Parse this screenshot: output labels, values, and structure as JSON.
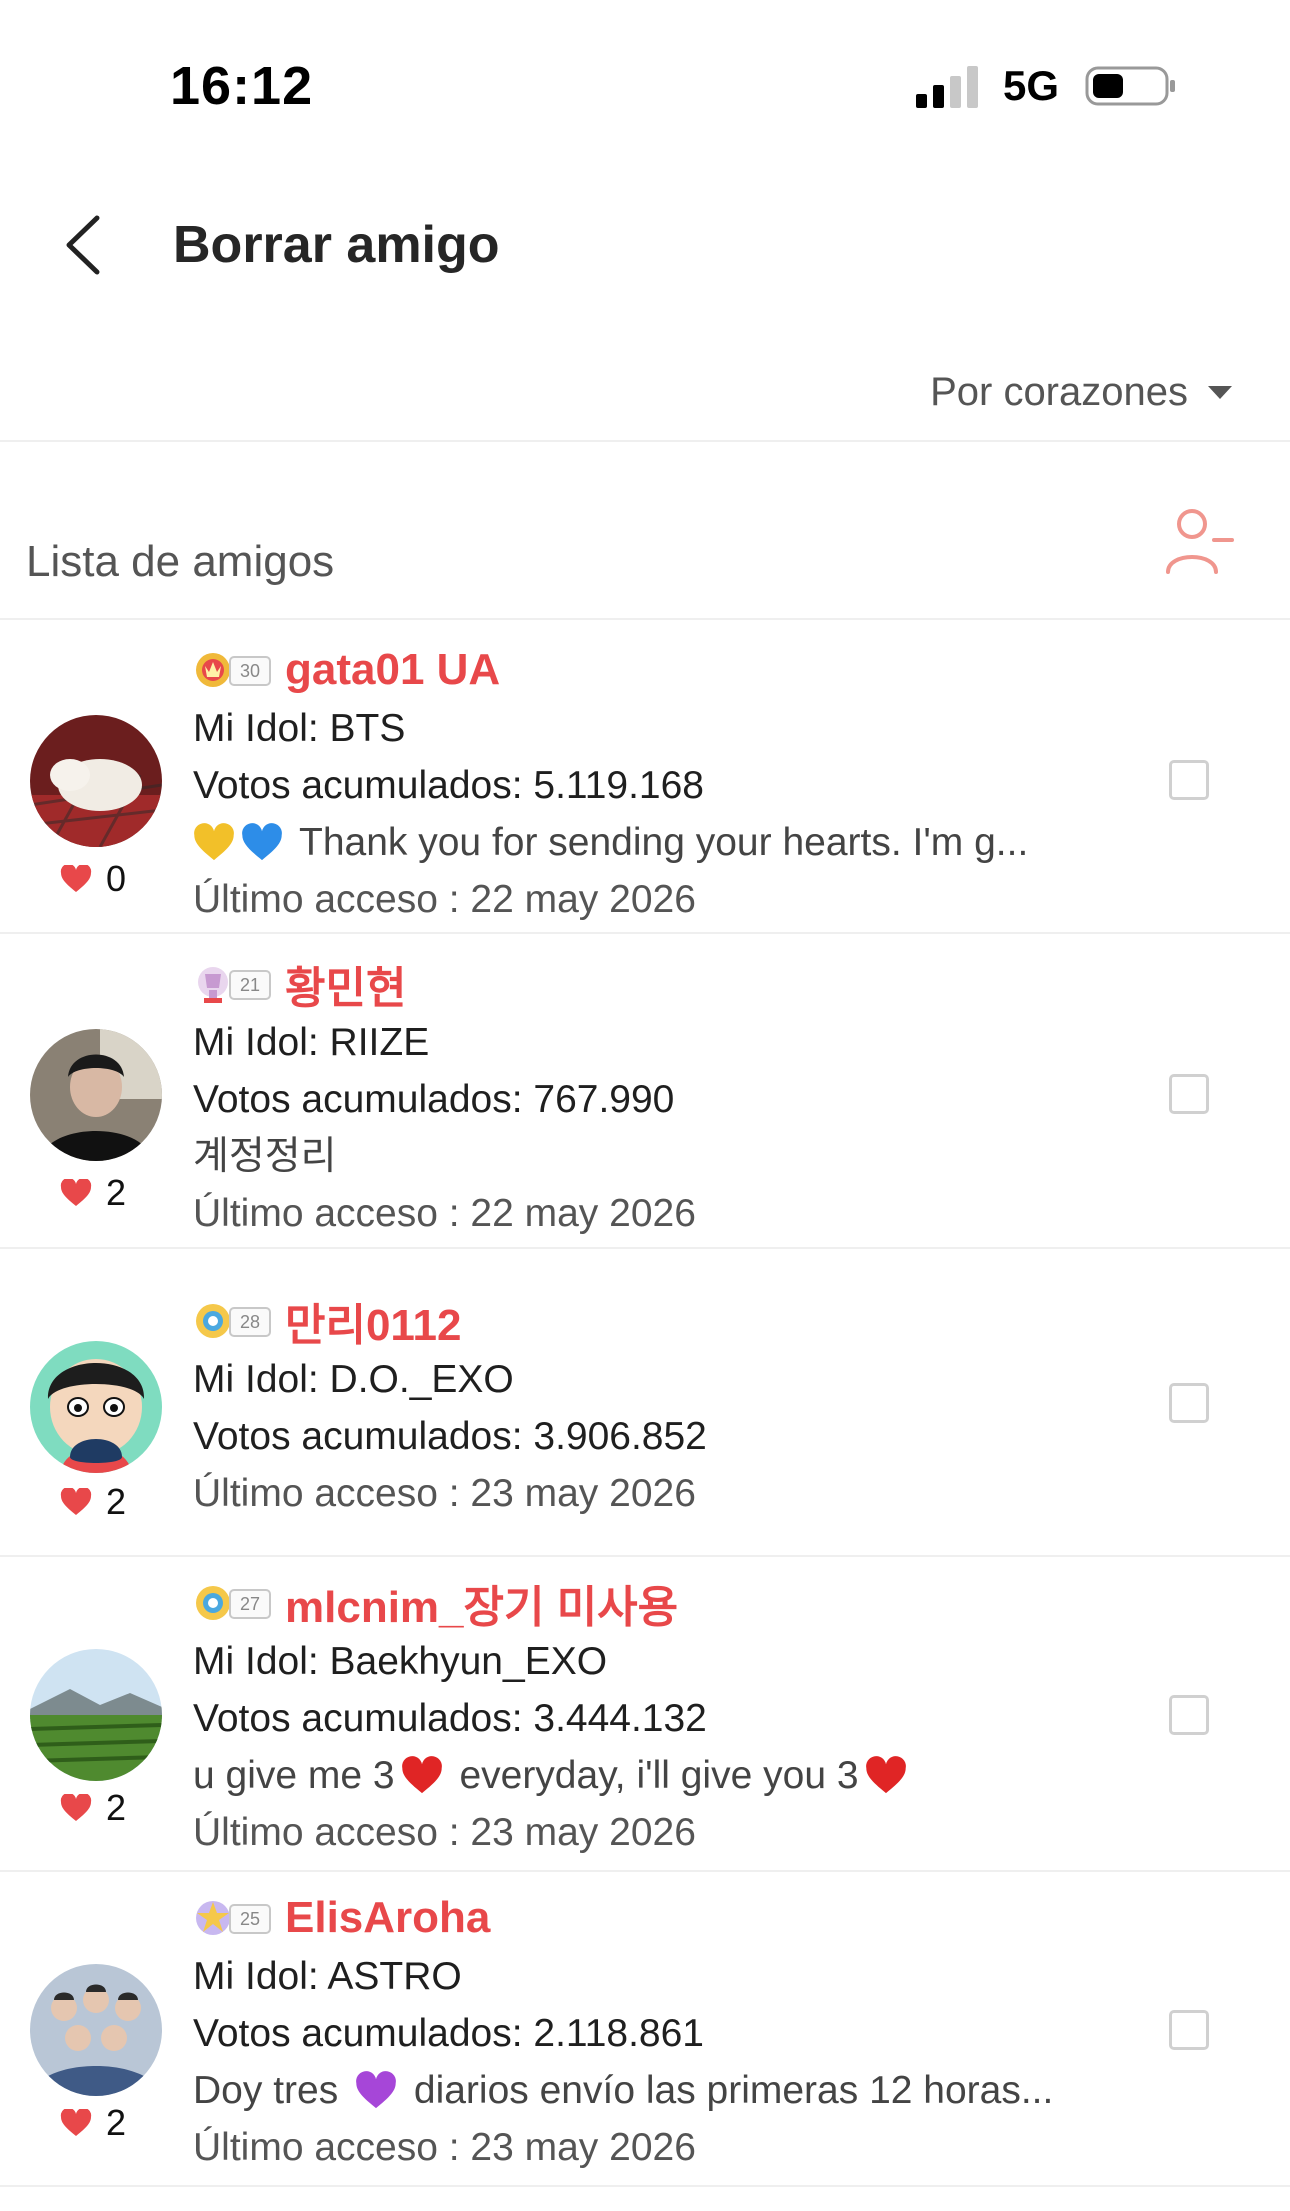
{
  "status_bar": {
    "time": "16:12",
    "network": "5G"
  },
  "nav": {
    "title": "Borrar amigo"
  },
  "sort": {
    "label": "Por corazones"
  },
  "list": {
    "title": "Lista de amigos"
  },
  "friends": [
    {
      "username": "gata01 UA",
      "level": "30",
      "idol": "Mi Idol: BTS",
      "votes": "Votos acumulados: 5.119.168",
      "message": "Thank you for sending your hearts. I'm g...",
      "last_access": "Último acceso : 22 may 2026",
      "hearts": "0",
      "avatar_icon": "white-cat-avatar"
    },
    {
      "username": "황민현",
      "level": "21",
      "idol": "Mi Idol: RIIZE",
      "votes": "Votos acumulados: 767.990",
      "message": "계정정리",
      "last_access": "Último acceso : 22 may 2026",
      "hearts": "2",
      "avatar_icon": "person-photo-avatar"
    },
    {
      "username": "만리0112",
      "level": "28",
      "idol": "Mi Idol: D.O._EXO",
      "votes": "Votos acumulados: 3.906.852",
      "message": "",
      "last_access": "Último acceso : 23 may 2026",
      "hearts": "2",
      "avatar_icon": "cartoon-boy-avatar"
    },
    {
      "username": "mlcnim_장기 미사용",
      "level": "27",
      "idol": "Mi Idol: Baekhyun_EXO",
      "votes": "Votos acumulados: 3.444.132",
      "message_a": "u give me 3",
      "message_b": " everyday, i'll give you 3",
      "last_access": "Último acceso : 23 may 2026",
      "hearts": "2",
      "avatar_icon": "field-landscape-avatar"
    },
    {
      "username": "ElisAroha",
      "level": "25",
      "idol": "Mi Idol: ASTRO",
      "votes": "Votos acumulados: 2.118.861",
      "message_a": "Doy tres ",
      "message_b": " diarios envío las primeras 12 horas...",
      "last_access": "Último acceso : 23 may 2026",
      "hearts": "2",
      "avatar_icon": "group-photo-avatar"
    }
  ],
  "colors": {
    "accent": "#e8484a",
    "heart": "#e8484a",
    "remove_icon": "#f0968e"
  }
}
